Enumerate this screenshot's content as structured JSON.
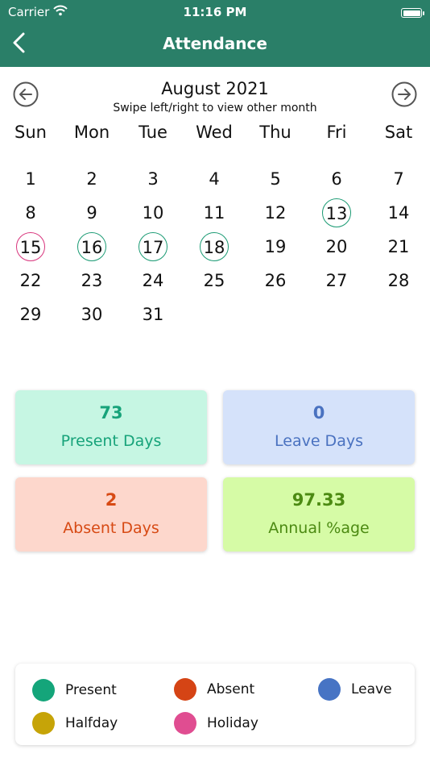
{
  "status_bar": {
    "carrier": "Carrier",
    "time": "11:16 PM"
  },
  "nav": {
    "title": "Attendance",
    "back_icon": "chevron-left-icon"
  },
  "calendar": {
    "month_title": "August 2021",
    "hint": "Swipe left/right to view other month",
    "prev_icon": "arrow-left-circle-icon",
    "next_icon": "arrow-right-circle-icon",
    "weekdays": [
      "Sun",
      "Mon",
      "Tue",
      "Wed",
      "Thu",
      "Fri",
      "Sat"
    ],
    "first_weekday_index": 0,
    "days_in_month": 31,
    "day_labels": [
      "1",
      "2",
      "3",
      "4",
      "5",
      "6",
      "7",
      "8",
      "9",
      "10",
      "11",
      "12",
      "13",
      "14",
      "15",
      "16",
      "17",
      "18",
      "19",
      "20",
      "21",
      "22",
      "23",
      "24",
      "25",
      "26",
      "27",
      "28",
      "29",
      "30",
      "31"
    ],
    "present_days": [
      13,
      16,
      17,
      18
    ],
    "holiday_days": [
      15
    ]
  },
  "stats": [
    {
      "value": "73",
      "label": "Present Days",
      "bg": "#c6f6e3",
      "color": "#17a37a"
    },
    {
      "value": "0",
      "label": "Leave Days",
      "bg": "#d5e2fa",
      "color": "#4a72c0"
    },
    {
      "value": "2",
      "label": "Absent Days",
      "bg": "#fdd7cc",
      "color": "#d74a14"
    },
    {
      "value": "97.33",
      "label": "Annual %age",
      "bg": "#d6fba6",
      "color": "#4c8a12"
    }
  ],
  "legend": [
    {
      "label": "Present",
      "color": "#14a57a"
    },
    {
      "label": "Absent",
      "color": "#d54415"
    },
    {
      "label": "Leave",
      "color": "#4774c4"
    },
    {
      "label": "Halfday",
      "color": "#c6a408"
    },
    {
      "label": "Holiday",
      "color": "#e04d91"
    }
  ],
  "colors": {
    "header": "#2a7f68",
    "present_ring": "#1a9a73",
    "holiday_ring": "#d8357d"
  }
}
